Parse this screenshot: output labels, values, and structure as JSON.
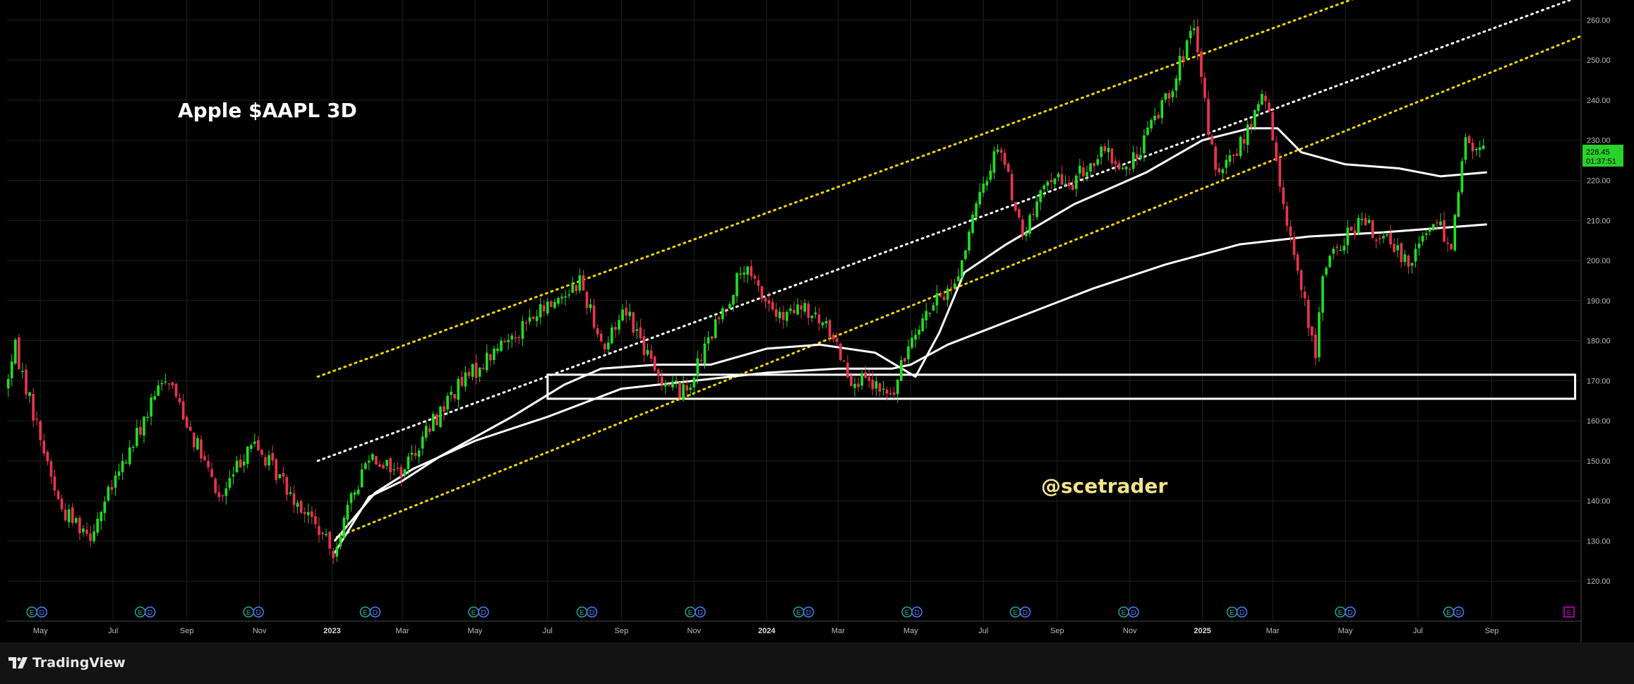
{
  "chart_data": {
    "type": "candlestick",
    "title": "Apple $AAPL 3D",
    "watermark_text": "@scetrader",
    "timeframe": "3D",
    "ylim": [
      110,
      265
    ],
    "y_ticks": [
      120,
      130,
      140,
      150,
      160,
      170,
      180,
      190,
      200,
      210,
      220,
      230,
      240,
      250,
      260
    ],
    "y_tick_labels": [
      "120.00",
      "130.00",
      "140.00",
      "150.00",
      "160.00",
      "170.00",
      "180.00",
      "190.00",
      "200.00",
      "210.00",
      "220.00",
      "230.00",
      "240.00",
      "250.00",
      "260.00"
    ],
    "x_tick_labels": [
      "May",
      "Jul",
      "Sep",
      "Nov",
      "2023",
      "Mar",
      "May",
      "Jul",
      "Sep",
      "Nov",
      "2024",
      "Mar",
      "May",
      "Jul",
      "Sep",
      "Nov",
      "2025",
      "Mar",
      "May",
      "Jul",
      "Sep"
    ],
    "x_tick_dates": [
      "2022-05-01",
      "2022-07-01",
      "2022-09-01",
      "2022-11-01",
      "2023-01-01",
      "2023-03-01",
      "2023-05-01",
      "2023-07-01",
      "2023-09-01",
      "2023-11-01",
      "2024-01-01",
      "2024-03-01",
      "2024-05-01",
      "2024-07-01",
      "2024-09-01",
      "2024-11-01",
      "2025-01-01",
      "2025-03-01",
      "2025-05-01",
      "2025-07-01",
      "2025-09-01"
    ],
    "x_start": "2022-04-03",
    "x_end": "2025-11-15",
    "price_anchors": [
      [
        "2022-04-03",
        168
      ],
      [
        "2022-04-12",
        178
      ],
      [
        "2022-05-20",
        138
      ],
      [
        "2022-06-14",
        132
      ],
      [
        "2022-08-17",
        172
      ],
      [
        "2022-10-01",
        140
      ],
      [
        "2022-10-26",
        155
      ],
      [
        "2022-11-20",
        146
      ],
      [
        "2022-12-20",
        134
      ],
      [
        "2023-01-03",
        127
      ],
      [
        "2023-02-03",
        152
      ],
      [
        "2023-03-01",
        147
      ],
      [
        "2023-04-14",
        167
      ],
      [
        "2023-06-01",
        181
      ],
      [
        "2023-07-30",
        195
      ],
      [
        "2023-08-20",
        178
      ],
      [
        "2023-09-06",
        189
      ],
      [
        "2023-10-01",
        172
      ],
      [
        "2023-10-26",
        167
      ],
      [
        "2023-12-14",
        198
      ],
      [
        "2024-01-15",
        185
      ],
      [
        "2024-02-01",
        188
      ],
      [
        "2024-02-27",
        182
      ],
      [
        "2024-03-13",
        171
      ],
      [
        "2024-04-18",
        166
      ],
      [
        "2024-05-05",
        183
      ],
      [
        "2024-06-10",
        195
      ],
      [
        "2024-06-27",
        213
      ],
      [
        "2024-07-16",
        230
      ],
      [
        "2024-08-05",
        206
      ],
      [
        "2024-08-30",
        222
      ],
      [
        "2024-09-10",
        218
      ],
      [
        "2024-10-12",
        227
      ],
      [
        "2024-11-01",
        222
      ],
      [
        "2024-12-10",
        245
      ],
      [
        "2024-12-26",
        258
      ],
      [
        "2025-01-15",
        220
      ],
      [
        "2025-02-10",
        232
      ],
      [
        "2025-02-24",
        242
      ],
      [
        "2025-03-10",
        218
      ],
      [
        "2025-04-08",
        175
      ],
      [
        "2025-04-14",
        198
      ],
      [
        "2025-05-15",
        210
      ],
      [
        "2025-06-25",
        200
      ],
      [
        "2025-07-15",
        210
      ],
      [
        "2025-07-31",
        205
      ],
      [
        "2025-08-12",
        230
      ],
      [
        "2025-08-25",
        227
      ]
    ],
    "last_price": "228.45",
    "countdown": "01:37:51",
    "series": [
      {
        "name": "",
        "type": "moving_average",
        "points": [
          [
            "2023-01-03",
            130
          ],
          [
            "2023-02-06",
            142
          ],
          [
            "2023-03-10",
            148
          ],
          [
            "2023-05-01",
            155
          ],
          [
            "2023-07-01",
            161
          ],
          [
            "2023-09-01",
            168
          ],
          [
            "2023-11-01",
            170
          ],
          [
            "2024-01-01",
            172
          ],
          [
            "2024-03-01",
            173
          ],
          [
            "2024-04-15",
            173
          ],
          [
            "2024-05-01",
            174
          ],
          [
            "2024-06-01",
            179
          ],
          [
            "2024-08-01",
            186
          ],
          [
            "2024-10-01",
            193
          ],
          [
            "2024-12-01",
            199
          ],
          [
            "2025-02-01",
            204
          ],
          [
            "2025-04-01",
            206
          ],
          [
            "2025-06-01",
            207
          ],
          [
            "2025-08-28",
            209
          ]
        ]
      },
      {
        "name": "",
        "type": "moving_average",
        "points": [
          [
            "2023-01-03",
            127
          ],
          [
            "2023-02-01",
            141
          ],
          [
            "2023-03-01",
            145
          ],
          [
            "2023-04-01",
            151
          ],
          [
            "2023-06-01",
            161
          ],
          [
            "2023-07-15",
            169
          ],
          [
            "2023-08-15",
            173
          ],
          [
            "2023-10-01",
            174
          ],
          [
            "2023-11-15",
            174
          ],
          [
            "2024-01-01",
            178
          ],
          [
            "2024-02-15",
            179
          ],
          [
            "2024-04-01",
            177
          ],
          [
            "2024-05-05",
            171
          ],
          [
            "2024-05-25",
            182
          ],
          [
            "2024-06-15",
            197
          ],
          [
            "2024-07-20",
            204
          ],
          [
            "2024-09-15",
            214
          ],
          [
            "2024-11-15",
            222
          ],
          [
            "2025-01-01",
            230
          ],
          [
            "2025-02-10",
            233
          ],
          [
            "2025-03-05",
            233
          ],
          [
            "2025-03-25",
            227
          ],
          [
            "2025-05-01",
            224
          ],
          [
            "2025-06-15",
            223
          ],
          [
            "2025-07-20",
            221
          ],
          [
            "2025-08-28",
            222
          ]
        ]
      }
    ],
    "annotations": {
      "support_box": {
        "x_from": "2023-07-01",
        "x_to": "2025-11-10",
        "y_from": 165.5,
        "y_to": 171.5
      },
      "channel_upper": {
        "from": [
          "2022-12-20",
          171
        ],
        "to": [
          "2025-11-15",
          286
        ],
        "style": "dotted",
        "color": "#f5d800"
      },
      "channel_middle": {
        "from": [
          "2022-12-20",
          150
        ],
        "to": [
          "2025-11-15",
          266
        ],
        "style": "dotted",
        "color": "#ffffff"
      },
      "channel_lower": {
        "from": [
          "2023-01-05",
          131
        ],
        "to": [
          "2025-11-15",
          256
        ],
        "style": "dotted",
        "color": "#f5d800"
      }
    },
    "event_markers": [
      "E",
      "E",
      "E",
      "E",
      "E",
      "E",
      "E",
      "E",
      "E",
      "E",
      "E",
      "E",
      "E",
      "E"
    ],
    "event_marker_dates": [
      "2022-04-28",
      "2022-07-28",
      "2022-10-27",
      "2023-02-02",
      "2023-05-04",
      "2023-08-03",
      "2023-11-02",
      "2024-02-01",
      "2024-05-02",
      "2024-08-01",
      "2024-10-31",
      "2025-01-30",
      "2025-05-01",
      "2025-07-31"
    ],
    "grid": true,
    "colors": {
      "background": "#000000",
      "up": "#22dd22",
      "down": "#e8344e",
      "grid": "#1f1f1f",
      "axis_text": "#bbbbbb",
      "title": "#ffffff",
      "watermark": "#f3e48a",
      "price_label_bg": "#2bd12b",
      "channel_yellow": "#f5d800",
      "ma_line": "#ffffff",
      "earnings_green": "#26a69a",
      "earnings_red": "#ef5350",
      "earnings_blue": "#4a7cff",
      "earnings_magenta": "#d100d1"
    }
  },
  "footer": {
    "brand": "TradingView"
  }
}
